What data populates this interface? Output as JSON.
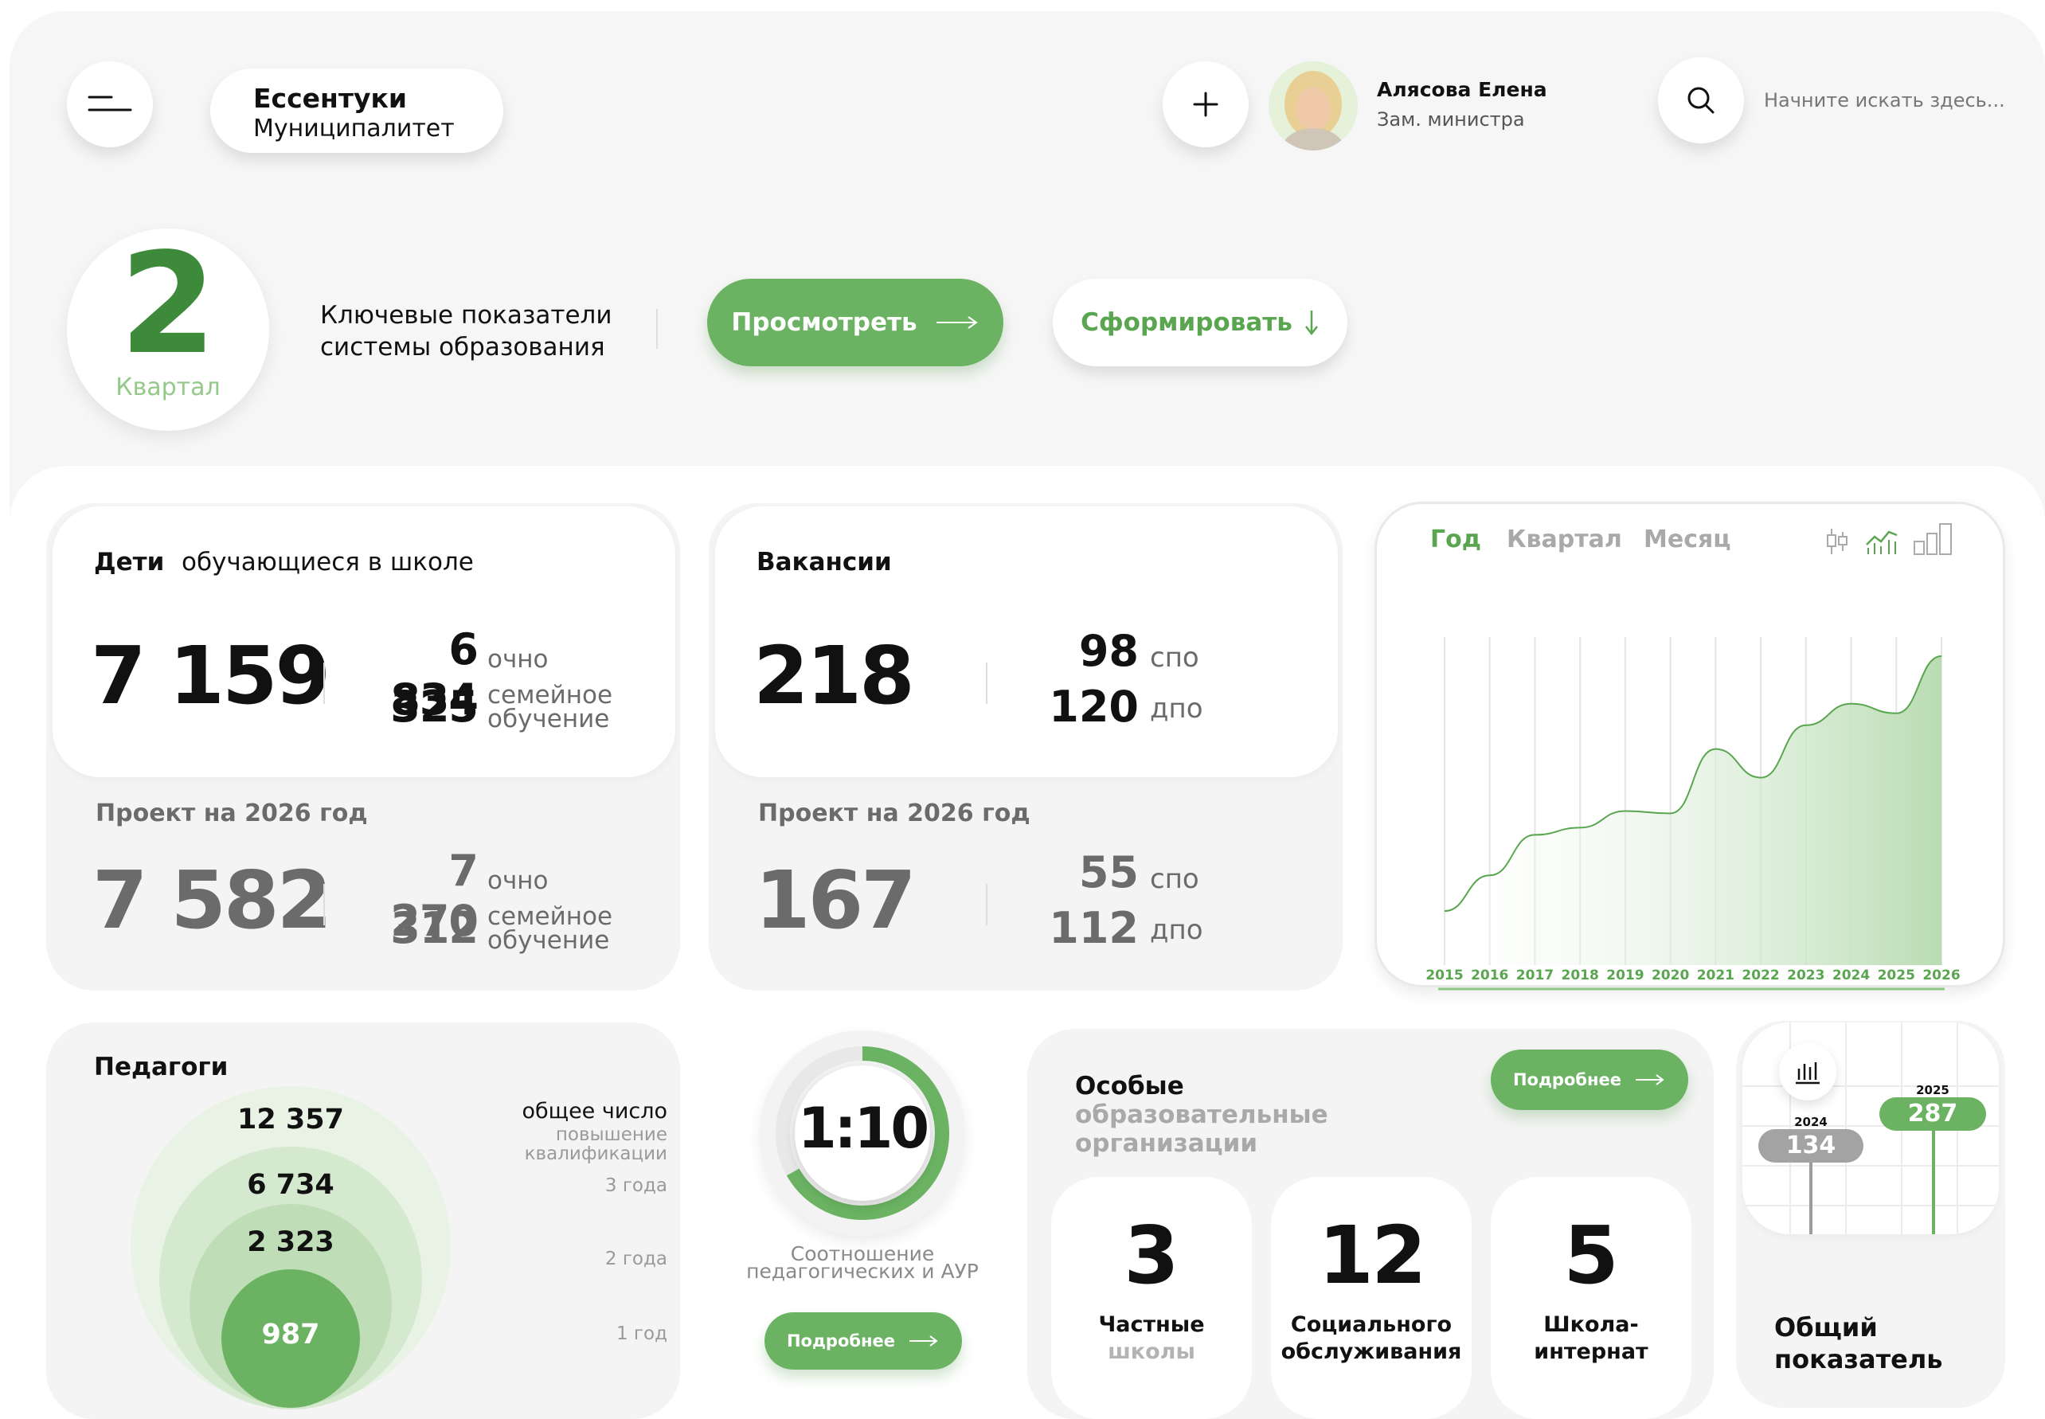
{
  "header": {
    "menu_icon": "menu-icon",
    "city": "Ессентуки",
    "city_sub": "Муниципалитет",
    "add_icon": "plus-icon",
    "user_name": "Алясова Елена",
    "user_role": "Зам. министра",
    "search_placeholder": "Начните искать здесь..."
  },
  "quarter": {
    "number": "2",
    "label": "Квартал",
    "title_line1": "Ключевые показатели",
    "title_line2": "системы образования",
    "view_button": "Просмотреть",
    "form_button": "Сформировать"
  },
  "children": {
    "title": "Дети",
    "subtitle": "обучающиеся в школе",
    "total": "7 159",
    "fulltime_value": "6 834",
    "fulltime_label": "очно",
    "family_value": "325",
    "family_label_1": "семейное",
    "family_label_2": "обучение",
    "project_title": "Проект на 2026 год",
    "project_total": "7 582",
    "project_fulltime_value": "7 270",
    "project_fulltime_label": "очно",
    "project_family_value": "312",
    "project_family_label_1": "семейное",
    "project_family_label_2": "обучение"
  },
  "vacancies": {
    "title": "Вакансии",
    "total": "218",
    "spo_value": "98",
    "spo_label": "спо",
    "dpo_value": "120",
    "dpo_label": "дпо",
    "project_title": "Проект на 2026 год",
    "project_total": "167",
    "project_spo_value": "55",
    "project_spo_label": "спо",
    "project_dpo_value": "112",
    "project_dpo_label": "дпо"
  },
  "trend_tabs": {
    "year": "Год",
    "quarter": "Квартал",
    "month": "Месяц",
    "icons": [
      "candlestick-icon",
      "line-chart-icon",
      "bar-chart-icon"
    ]
  },
  "chart_data": {
    "type": "area",
    "x": [
      "2015",
      "2016",
      "2017",
      "2018",
      "2019",
      "2020",
      "2021",
      "2022",
      "2023",
      "2024",
      "2025",
      "2026"
    ],
    "values": [
      20,
      35,
      52,
      55,
      62,
      61,
      88,
      76,
      98,
      107,
      103,
      127
    ],
    "title": "",
    "xlabel": "",
    "ylabel": "",
    "grid": true,
    "colors": {
      "line": "#5aa54f",
      "fill": "#b9dcb2"
    }
  },
  "teachers": {
    "title": "Педагоги",
    "values": [
      "12 357",
      "6 734",
      "2 323",
      "987"
    ],
    "labels": [
      "общее число",
      "повышение",
      "квалификации",
      "3 года",
      "2 года",
      "1 год"
    ]
  },
  "ratio": {
    "value": "1:10",
    "label_1": "Соотношение",
    "label_2": "педагогических и АУР",
    "button": "Подробнее"
  },
  "special": {
    "title_1": "Особые",
    "title_2": "образовательные",
    "title_3": "организации",
    "button": "Подробнее",
    "items": [
      {
        "value": "3",
        "label_1": "Частные",
        "label_2": "школы"
      },
      {
        "value": "12",
        "label_1": "Социального",
        "label_2": "обслуживания"
      },
      {
        "value": "5",
        "label_1": "Школа-",
        "label_2": "интернат"
      }
    ]
  },
  "overall": {
    "icon": "bar-chart-icon",
    "year_1": "2024",
    "value_1": "134",
    "year_2": "2025",
    "value_2": "287",
    "label_1": "Общий",
    "label_2": "показатель"
  }
}
